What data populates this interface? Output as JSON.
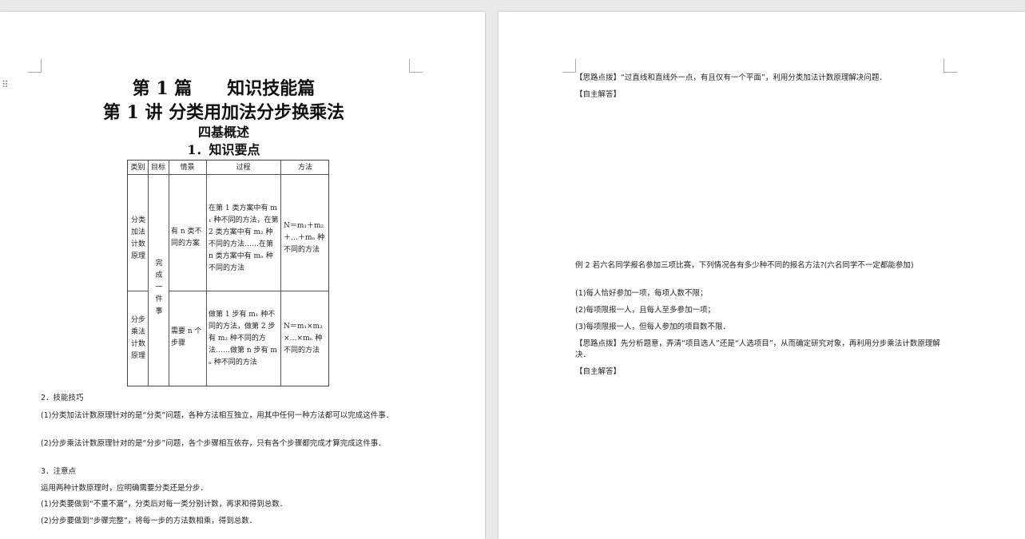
{
  "left_page": {
    "titles": {
      "part": "第 1 篇　　知识技能篇",
      "lecture": "第 1 讲 分类用加法分步换乘法",
      "overview": "四基概述",
      "section1": "1．知识要点"
    },
    "table": {
      "headers": [
        "类别",
        "目标",
        "情景",
        "过程",
        "方法"
      ],
      "goal": "完成一件事",
      "rows": [
        {
          "category": "分类加法计数原理",
          "situation": "有 n 类不同的方案",
          "process": "在第 1 类方案中有 m₁ 种不同的方法，在第 2 类方案中有 m₂ 种不同的方法……在第 n 类方案中有 mₙ 种不同的方法",
          "method": "N＝m₁＋m₂＋…＋mₙ 种不同的方法"
        },
        {
          "category": "分步乘法计数原理",
          "situation": "需要 n 个步骤",
          "process": "做第 1 步有 m₁ 种不同的方法，做第 2 步有 m₂ 种不同的方法……做第 n 步有 mₙ 种不同的方法",
          "method": "N＝m₁×m₂×…×mₙ 种不同的方法"
        }
      ]
    },
    "section2": "2．技能技巧",
    "tip1": "(1)分类加法计数原理针对的是“分类”问题，各种方法相互独立，用其中任何一种方法都可以完成这件事．",
    "tip2": "(2)分步乘法计数原理针对的是“分步”问题，各个步骤相互依存，只有各个步骤都完成才算完成这件事．",
    "section3": "3．注意点",
    "note0": "运用两种计数原理时，应明确需要分类还是分步．",
    "note1": "(1)分类要做到“不重不漏”，分类后对每一类分别计数，再求和得到总数．",
    "note2": "(2)分步要做到“步骤完整”，将每一步的方法数相乘，得到总数．"
  },
  "right_page": {
    "hint1": "【思路点拨】“过直线和直线外一点，有且仅有一个平面”，利用分类加法计数原理解决问题．",
    "answer1": "【自主解答】",
    "example2": "例 2 若六名同学报名参加三项比赛，下列情况各有多少种不同的报名方法?(六名同学不一定都能参加)",
    "q1": "(1)每人恰好参加一项，每项人数不限；",
    "q2": "(2)每项限报一人，且每人至多参加一项；",
    "q3": "(3)每项限报一人，但每人参加的项目数不限．",
    "hint2": "【思路点拨】先分析题意，弄清“项目选人”还是“人选项目”，从而确定研究对象，再利用分步乘法计数原理解决．",
    "answer2": "【自主解答】"
  }
}
